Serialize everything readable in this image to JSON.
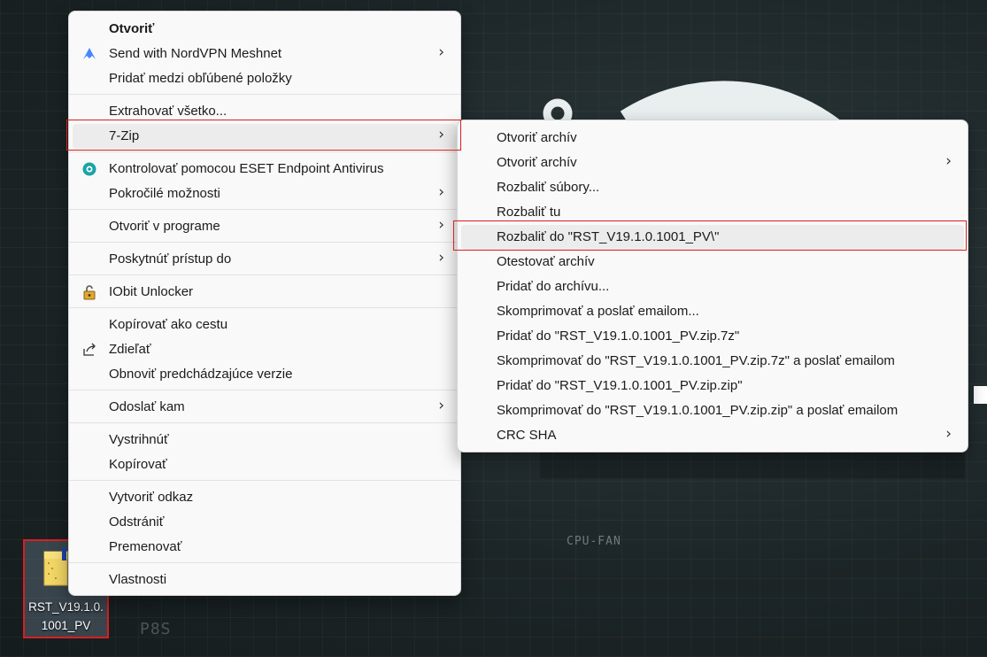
{
  "desktop": {
    "file_label": "RST_V19.1.0.1001_PV",
    "wallpaper_text_cpufan": "CPU-FAN",
    "wallpaper_text_p8s": "P8S"
  },
  "context_menu": {
    "items": [
      {
        "label": "Otvoriť",
        "bold": true
      },
      {
        "label": "Send with NordVPN Meshnet",
        "icon": "nordvpn-icon",
        "submenu": true
      },
      {
        "label": "Pridať medzi obľúbené položky"
      },
      {
        "label": "Extrahovať všetko..."
      },
      {
        "label": "7-Zip",
        "submenu": true
      },
      {
        "label": "Kontrolovať pomocou ESET Endpoint Antivirus",
        "icon": "eset-icon"
      },
      {
        "label": "Pokročilé možnosti",
        "submenu": true
      },
      {
        "label": "Otvoriť v programe",
        "submenu": true
      },
      {
        "label": "Poskytnúť prístup do",
        "submenu": true
      },
      {
        "label": "IObit Unlocker",
        "icon": "iobit-unlocker-icon"
      },
      {
        "label": "Kopírovať ako cestu"
      },
      {
        "label": "Zdieľať",
        "icon": "share-icon"
      },
      {
        "label": "Obnoviť predchádzajúce verzie"
      },
      {
        "label": "Odoslať kam",
        "submenu": true
      },
      {
        "label": "Vystrihnúť"
      },
      {
        "label": "Kopírovať"
      },
      {
        "label": "Vytvoriť odkaz"
      },
      {
        "label": "Odstrániť"
      },
      {
        "label": "Premenovať"
      },
      {
        "label": "Vlastnosti"
      }
    ]
  },
  "zip_submenu": {
    "items": [
      {
        "label": "Otvoriť archív"
      },
      {
        "label": "Otvoriť archív",
        "submenu": true
      },
      {
        "label": "Rozbaliť súbory..."
      },
      {
        "label": "Rozbaliť tu"
      },
      {
        "label": "Rozbaliť do \"RST_V19.1.0.1001_PV\\\""
      },
      {
        "label": "Otestovať archív"
      },
      {
        "label": "Pridať do archívu..."
      },
      {
        "label": "Skomprimovať a poslať emailom..."
      },
      {
        "label": "Pridať do \"RST_V19.1.0.1001_PV.zip.7z\""
      },
      {
        "label": "Skomprimovať do \"RST_V19.1.0.1001_PV.zip.7z\" a poslať emailom"
      },
      {
        "label": "Pridať do \"RST_V19.1.0.1001_PV.zip.zip\""
      },
      {
        "label": "Skomprimovať do \"RST_V19.1.0.1001_PV.zip.zip\" a poslať emailom"
      },
      {
        "label": "CRC SHA",
        "submenu": true
      }
    ]
  },
  "chevron_glyph": "›",
  "colors": {
    "highlight_border": "#d81f1f",
    "menu_bg": "#f9f9f9",
    "hover_bg": "#ececec"
  }
}
